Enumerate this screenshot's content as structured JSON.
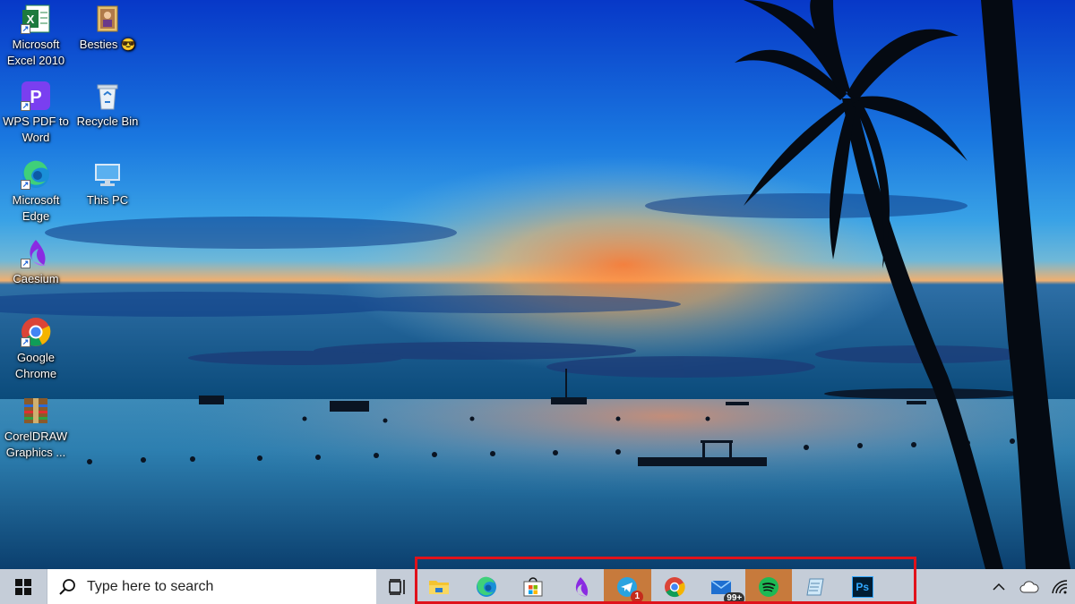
{
  "desktop": {
    "icons": [
      {
        "label": "Microsoft\nExcel 2010",
        "icon": "excel-icon"
      },
      {
        "label": "Besties 😎",
        "icon": "folder-photo-icon"
      },
      {
        "label": "WPS PDF to\nWord",
        "icon": "wps-pdf-icon"
      },
      {
        "label": "Recycle Bin",
        "icon": "recycle-bin-icon"
      },
      {
        "label": "Microsoft\nEdge",
        "icon": "edge-icon"
      },
      {
        "label": "This PC",
        "icon": "this-pc-icon"
      },
      {
        "label": "Caesium",
        "icon": "caesium-icon"
      },
      {
        "label": "Google\nChrome",
        "icon": "chrome-icon"
      },
      {
        "label": "CorelDRAW\nGraphics ...",
        "icon": "coreldraw-icon"
      }
    ]
  },
  "taskbar": {
    "search_placeholder": "Type here to search",
    "pinned_apps": [
      {
        "name": "File Explorer",
        "icon": "file-explorer-icon",
        "active": false
      },
      {
        "name": "Microsoft Edge",
        "icon": "edge-icon",
        "active": false
      },
      {
        "name": "Microsoft Store",
        "icon": "store-icon",
        "active": false
      },
      {
        "name": "Caesium",
        "icon": "caesium-icon",
        "active": false
      },
      {
        "name": "Telegram",
        "icon": "telegram-icon",
        "active": true,
        "badge": "1"
      },
      {
        "name": "Google Chrome",
        "icon": "chrome-icon",
        "active": false
      },
      {
        "name": "Mail",
        "icon": "mail-icon",
        "active": false,
        "badge": "99+"
      },
      {
        "name": "Spotify",
        "icon": "spotify-icon",
        "active": true
      },
      {
        "name": "Notepad",
        "icon": "notepad-icon",
        "active": false
      },
      {
        "name": "Photoshop",
        "icon": "photoshop-icon",
        "active": false,
        "label": "Ps"
      }
    ],
    "tray": [
      "chevron-up-icon",
      "onedrive-icon",
      "wifi-icon"
    ]
  },
  "colors": {
    "highlight_border": "#e0121b",
    "taskbar_bg": "#c5cdd8",
    "active_app_bg": "#c77a3c"
  }
}
